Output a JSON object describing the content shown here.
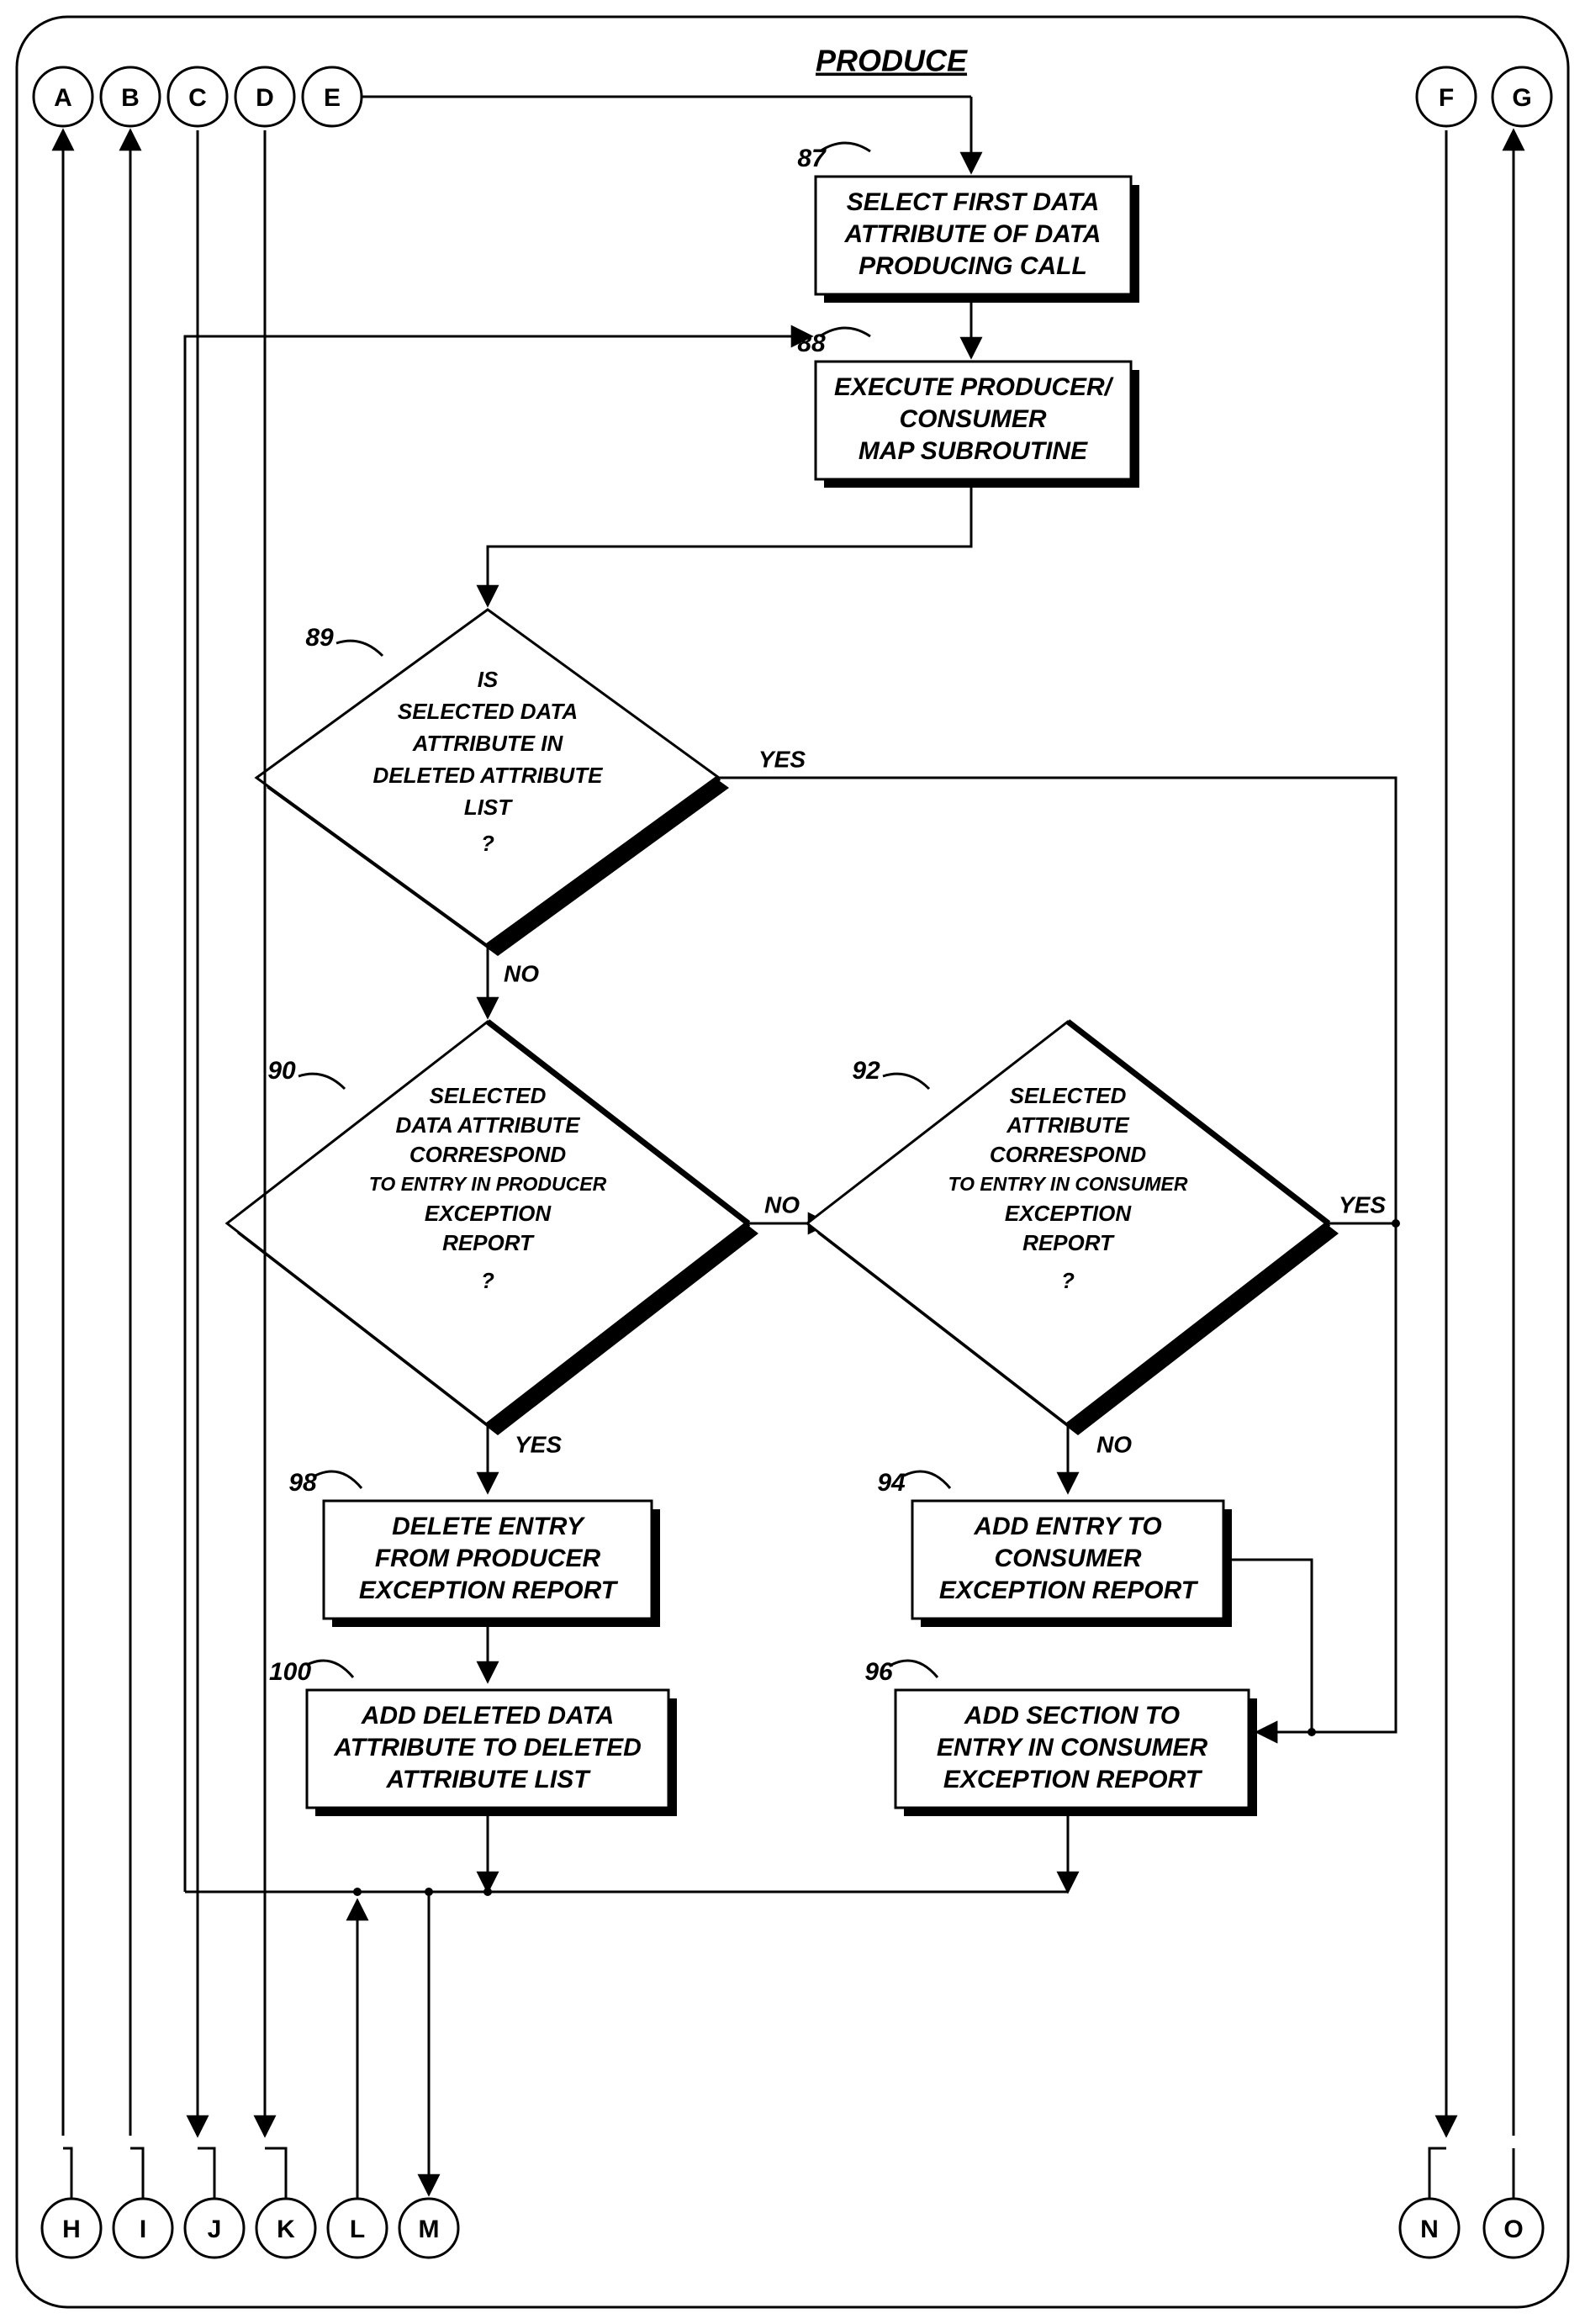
{
  "title": "PRODUCE",
  "connectors": {
    "top": [
      "A",
      "B",
      "C",
      "D",
      "E"
    ],
    "topRight": [
      "F",
      "G"
    ],
    "bottom": [
      "H",
      "I",
      "J",
      "K",
      "L",
      "M"
    ],
    "bottomRight": [
      "N",
      "O"
    ]
  },
  "refs": {
    "b87": "87",
    "b88": "88",
    "d89": "89",
    "d90": "90",
    "d92": "92",
    "b94": "94",
    "b96": "96",
    "b98": "98",
    "b100": "100"
  },
  "blocks": {
    "b87": [
      "SELECT FIRST DATA",
      "ATTRIBUTE OF DATA",
      "PRODUCING CALL"
    ],
    "b88": [
      "EXECUTE PRODUCER/",
      "CONSUMER",
      "MAP SUBROUTINE"
    ],
    "b94": [
      "ADD ENTRY TO",
      "CONSUMER",
      "EXCEPTION REPORT"
    ],
    "b96": [
      "ADD SECTION TO",
      "ENTRY IN CONSUMER",
      "EXCEPTION REPORT"
    ],
    "b98": [
      "DELETE ENTRY",
      "FROM PRODUCER",
      "EXCEPTION REPORT"
    ],
    "b100": [
      "ADD DELETED DATA",
      "ATTRIBUTE TO DELETED",
      "ATTRIBUTE LIST"
    ]
  },
  "decisions": {
    "d89": [
      "IS",
      "SELECTED DATA",
      "ATTRIBUTE IN",
      "DELETED ATTRIBUTE",
      "LIST",
      "?"
    ],
    "d90": [
      "SELECTED",
      "DATA ATTRIBUTE",
      "CORRESPOND",
      "TO ENTRY IN PRODUCER",
      "EXCEPTION",
      "REPORT",
      "?"
    ],
    "d92": [
      "SELECTED",
      "ATTRIBUTE",
      "CORRESPOND",
      "TO ENTRY IN CONSUMER",
      "EXCEPTION",
      "REPORT",
      "?"
    ]
  },
  "labels": {
    "yes": "YES",
    "no": "NO"
  }
}
